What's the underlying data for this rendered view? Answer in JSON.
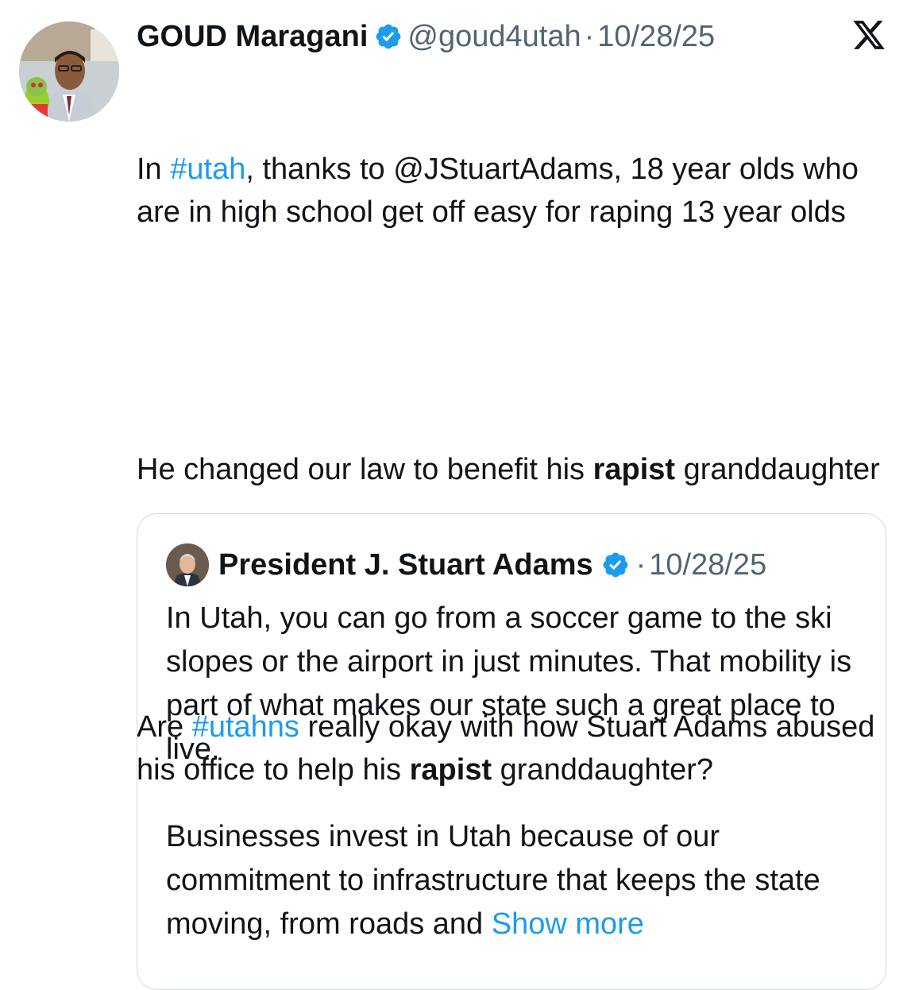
{
  "tweet": {
    "author_name": "GOUD Maragani",
    "handle": "@goud4utah",
    "separator": "·",
    "date": "10/28/25",
    "line1_pre": "In ",
    "line1_hashtag": "#utah",
    "line1_post": ", thanks to @JStuartAdams, 18 year olds who are in high school get off easy for raping 13 year olds",
    "para2_pre": "He changed our law to benefit his ",
    "para2_bold": "rapist",
    "para2_post": " granddaughter",
    "para3_pre": "Are ",
    "para3_hashtag": "#utahns",
    "para3_mid": " really okay with how Stuart Adams abused his office to help his ",
    "para3_bold": "rapist",
    "para3_post": " granddaughter?"
  },
  "quoted": {
    "author_name": "President J. Stuart Adams",
    "separator": "·",
    "date": "10/28/25",
    "para1": "In Utah, you can go from a soccer game to the ski slopes or the airport in just minutes. That mobility is part of what makes our state such a great place to live.",
    "para2": "Businesses invest in Utah because of our commitment to infrastructure that keeps the state moving, from roads and ",
    "show_more": "Show more"
  },
  "colors": {
    "link": "#1d9bf0",
    "verified": "#1d9bf0",
    "text": "#0f1419",
    "muted": "#536471",
    "border": "#cfd9de"
  },
  "icons": {
    "platform_logo": "x-logo-icon",
    "verified": "verified-badge-icon"
  }
}
